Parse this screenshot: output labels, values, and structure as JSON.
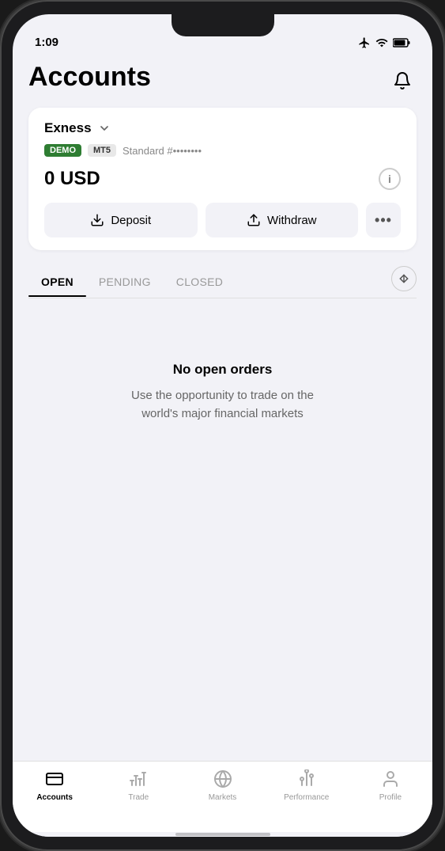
{
  "statusBar": {
    "time": "1:09",
    "icons": [
      "airplane",
      "wifi",
      "battery"
    ]
  },
  "header": {
    "title": "Accounts",
    "notificationIcon": "bell"
  },
  "accountCard": {
    "brokerName": "Exness",
    "badges": {
      "demo": "DEMO",
      "platform": "MT5"
    },
    "accountType": "Standard #••••••••",
    "balance": "0 USD",
    "infoIcon": "i",
    "depositLabel": "Deposit",
    "withdrawLabel": "Withdraw",
    "moreLabel": "..."
  },
  "tabs": {
    "items": [
      {
        "label": "OPEN",
        "active": true
      },
      {
        "label": "PENDING",
        "active": false
      },
      {
        "label": "CLOSED",
        "active": false
      }
    ],
    "sortIcon": "sort"
  },
  "emptyState": {
    "title": "No open orders",
    "description": "Use the opportunity to trade on the world's major financial markets"
  },
  "bottomNav": {
    "items": [
      {
        "label": "Accounts",
        "active": true,
        "icon": "accounts"
      },
      {
        "label": "Trade",
        "active": false,
        "icon": "trade"
      },
      {
        "label": "Markets",
        "active": false,
        "icon": "markets"
      },
      {
        "label": "Performance",
        "active": false,
        "icon": "performance"
      },
      {
        "label": "Profile",
        "active": false,
        "icon": "profile"
      }
    ]
  }
}
